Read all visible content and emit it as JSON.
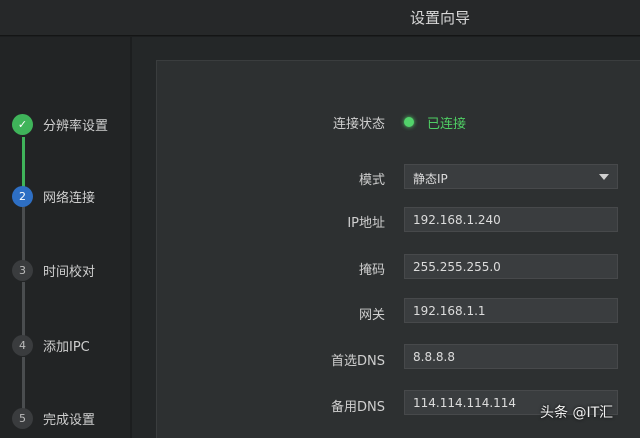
{
  "window": {
    "title": "设置向导"
  },
  "steps": [
    {
      "num": "✓",
      "label": "分辨率设置",
      "state": "done"
    },
    {
      "num": "2",
      "label": "网络连接",
      "state": "active"
    },
    {
      "num": "3",
      "label": "时间校对",
      "state": "pending"
    },
    {
      "num": "4",
      "label": "添加IPC",
      "state": "pending"
    },
    {
      "num": "5",
      "label": "完成设置",
      "state": "pending"
    }
  ],
  "form": {
    "status_label": "连接状态",
    "status_value": "已连接",
    "mode_label": "模式",
    "mode_value": "静态IP",
    "ip_label": "IP地址",
    "ip_value": "192.168.1.240",
    "mask_label": "掩码",
    "mask_value": "255.255.255.0",
    "gateway_label": "网关",
    "gateway_value": "192.168.1.1",
    "dns1_label": "首选DNS",
    "dns1_value": "8.8.8.8",
    "dns2_label": "备用DNS",
    "dns2_value": "114.114.114.114"
  },
  "watermark": {
    "text": "头条 @IT汇"
  },
  "colors": {
    "success": "#52d36b",
    "active": "#2e6fc4"
  }
}
